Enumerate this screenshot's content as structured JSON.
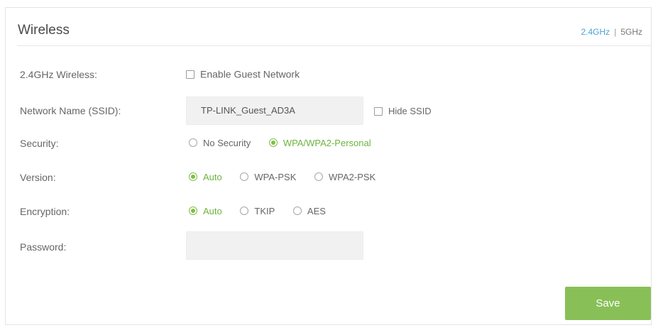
{
  "section": {
    "title": "Wireless",
    "band_active": "2.4GHz",
    "band_separator": "|",
    "band_other": "5GHz"
  },
  "wireless_row": {
    "label": "2.4GHz Wireless:",
    "enable_guest_label": "Enable Guest Network",
    "enable_guest_checked": false
  },
  "ssid_row": {
    "label": "Network Name (SSID):",
    "value": "TP-LINK_Guest_AD3A",
    "hide_ssid_label": "Hide SSID",
    "hide_ssid_checked": false
  },
  "security_row": {
    "label": "Security:",
    "options": [
      {
        "label": "No Security",
        "checked": false
      },
      {
        "label": "WPA/WPA2-Personal",
        "checked": true
      }
    ]
  },
  "version_row": {
    "label": "Version:",
    "options": [
      {
        "label": "Auto",
        "checked": true
      },
      {
        "label": "WPA-PSK",
        "checked": false
      },
      {
        "label": "WPA2-PSK",
        "checked": false
      }
    ]
  },
  "encryption_row": {
    "label": "Encryption:",
    "options": [
      {
        "label": "Auto",
        "checked": true
      },
      {
        "label": "TKIP",
        "checked": false
      },
      {
        "label": "AES",
        "checked": false
      }
    ]
  },
  "password_row": {
    "label": "Password:",
    "value": ""
  },
  "actions": {
    "save_label": "Save"
  },
  "colors": {
    "accent_green": "#88c057",
    "selected_text": "#6db33f",
    "link_blue": "#4aa3d6"
  }
}
